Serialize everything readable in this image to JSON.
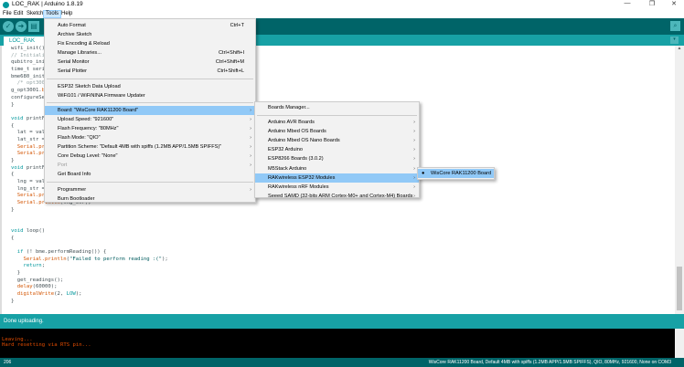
{
  "window": {
    "title": "LOC_RAK | Arduino 1.8.19",
    "minimize": "—",
    "maximize": "❐",
    "close": "✕"
  },
  "menubar": [
    "File",
    "Edit",
    "Sketch",
    "Tools",
    "Help"
  ],
  "toolbar": {
    "verify": "✓",
    "upload": "➜",
    "new": "▤",
    "serial_monitor": "⌕"
  },
  "tab": {
    "label": "LOC_RAK",
    "menu": "▾"
  },
  "code": [
    [
      [
        "pl",
        "wifi_init()"
      ]
    ],
    [
      [
        "cm",
        "// Initiali"
      ]
    ],
    [
      [
        "pl",
        "qubitro_ini"
      ]
    ],
    [
      [
        "pl",
        "time_t seri"
      ]
    ],
    [
      [
        "pl",
        "bme680_init"
      ]
    ],
    [
      [
        "cm",
        "  /* opt300"
      ]
    ],
    [
      [
        "pl",
        "g_opt3001."
      ],
      [
        "fn",
        "b"
      ]
    ],
    [
      [
        "pl",
        "configureSe"
      ]
    ],
    [
      [
        "pl",
        "}"
      ]
    ],
    [
      [
        "pl",
        ""
      ]
    ],
    [
      [
        "kw",
        "void"
      ],
      [
        "pl",
        " printFlo"
      ]
    ],
    [
      [
        "pl",
        "{"
      ]
    ],
    [
      [
        "pl",
        "  lat = val;"
      ]
    ],
    [
      [
        "pl",
        "  lat_str = S"
      ]
    ],
    [
      [
        "fn",
        "  Serial.prin"
      ]
    ],
    [
      [
        "fn",
        "  Serial.prin"
      ]
    ],
    [
      [
        "pl",
        "}"
      ]
    ],
    [
      [
        "kw",
        "void"
      ],
      [
        "pl",
        " printFlo"
      ]
    ],
    [
      [
        "pl",
        "{"
      ]
    ],
    [
      [
        "pl",
        "  lng = val;"
      ]
    ],
    [
      [
        "pl",
        "  lng_str = S"
      ]
    ],
    [
      [
        "fn",
        "  Serial.prin"
      ]
    ],
    [
      [
        "fn",
        "  Serial.println"
      ],
      [
        "pl",
        "(lng_str);"
      ]
    ],
    [
      [
        "pl",
        "}"
      ]
    ],
    [
      [
        "pl",
        ""
      ]
    ],
    [
      [
        "pl",
        ""
      ]
    ],
    [
      [
        "kw",
        "void"
      ],
      [
        "pl",
        " loop()"
      ]
    ],
    [
      [
        "pl",
        "{"
      ]
    ],
    [
      [
        "pl",
        ""
      ]
    ],
    [
      [
        "kw",
        "  if"
      ],
      [
        "pl",
        " (! bme.performReading()) {"
      ]
    ],
    [
      [
        "fn",
        "    Serial.println"
      ],
      [
        "pl",
        "("
      ],
      [
        "st",
        "\"Failed to perform reading :(\""
      ],
      [
        "pl",
        ");"
      ]
    ],
    [
      [
        "kw",
        "    return"
      ],
      [
        "pl",
        ";"
      ]
    ],
    [
      [
        "pl",
        "  }"
      ]
    ],
    [
      [
        "pl",
        "  get_readings();"
      ]
    ],
    [
      [
        "fn",
        "  delay"
      ],
      [
        "pl",
        "(60000);"
      ]
    ],
    [
      [
        "fn",
        "  digitalWrite"
      ],
      [
        "pl",
        "(2, "
      ],
      [
        "kw",
        "LOW"
      ],
      [
        "pl",
        ");"
      ]
    ],
    [
      [
        "pl",
        "}"
      ]
    ]
  ],
  "status": {
    "message": "Done uploading.",
    "line_number": "206",
    "board_info": "WisCore RAK11200 Board, Default 4MB with spiffs (1.2MB APP/1.5MB SPIFFS), QIO, 80MHz, 921600, None on COM3"
  },
  "console": [
    "Leaving...",
    "Hard resetting via RTS pin..."
  ],
  "tools_menu": {
    "items": [
      {
        "label": "Auto Format",
        "shortcut": "Ctrl+T"
      },
      {
        "label": "Archive Sketch",
        "shortcut": ""
      },
      {
        "label": "Fix Encoding & Reload",
        "shortcut": ""
      },
      {
        "label": "Manage Libraries...",
        "shortcut": "Ctrl+Shift+I"
      },
      {
        "label": "Serial Monitor",
        "shortcut": "Ctrl+Shift+M"
      },
      {
        "label": "Serial Plotter",
        "shortcut": "Ctrl+Shift+L"
      },
      {
        "sep": true
      },
      {
        "label": "ESP32 Sketch Data Upload",
        "shortcut": ""
      },
      {
        "label": "WiFi101 / WiFiNINA Firmware Updater",
        "shortcut": ""
      },
      {
        "sep": true
      },
      {
        "label": "Board: \"WisCore RAK11200 Board\"",
        "sub": true,
        "hl": true
      },
      {
        "label": "Upload Speed: \"921600\"",
        "sub": true
      },
      {
        "label": "Flash Frequency: \"80MHz\"",
        "sub": true
      },
      {
        "label": "Flash Mode: \"QIO\"",
        "sub": true
      },
      {
        "label": "Partition Scheme: \"Default 4MB with spiffs (1.2MB APP/1.5MB SPIFFS)\"",
        "sub": true
      },
      {
        "label": "Core Debug Level: \"None\"",
        "sub": true
      },
      {
        "label": "Port",
        "sub": true,
        "dis": true
      },
      {
        "label": "Get Board Info"
      },
      {
        "sep": true
      },
      {
        "label": "Programmer",
        "sub": true
      },
      {
        "label": "Burn Bootloader"
      }
    ]
  },
  "board_menu": {
    "items": [
      {
        "label": "Boards Manager..."
      },
      {
        "sep": true
      },
      {
        "label": "Arduino AVR Boards",
        "sub": true
      },
      {
        "label": "Arduino Mbed OS Boards",
        "sub": true
      },
      {
        "label": "Arduino Mbed OS Nano Boards",
        "sub": true
      },
      {
        "label": "ESP32 Arduino",
        "sub": true
      },
      {
        "label": "ESP8266 Boards (3.0.2)",
        "sub": true
      },
      {
        "label": "M5Stack Arduino",
        "sub": true
      },
      {
        "label": "RAKwireless ESP32 Modules",
        "sub": true,
        "hl": true
      },
      {
        "label": "RAKwireless nRF Modules",
        "sub": true
      },
      {
        "label": "Seeed SAMD (32-bits ARM Cortex-M0+ and Cortex-M4) Boards",
        "sub": true
      }
    ]
  },
  "rak_menu": {
    "items": [
      {
        "label": "WisCore RAK11200 Board",
        "hl": true,
        "selected": true,
        "bullet": "●"
      }
    ]
  },
  "arrow": "›"
}
